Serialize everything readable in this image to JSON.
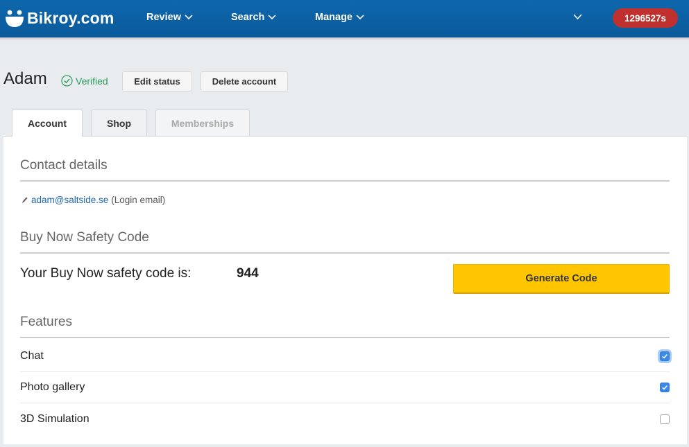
{
  "header": {
    "brand": "Bikroy.com",
    "nav": [
      {
        "label": "Review"
      },
      {
        "label": "Search"
      },
      {
        "label": "Manage"
      }
    ],
    "user_id_badge": "1296527s"
  },
  "profile": {
    "name": "Adam",
    "verified_label": "Verified",
    "edit_status_label": "Edit status",
    "delete_account_label": "Delete account"
  },
  "tabs": [
    {
      "label": "Account",
      "state": "active"
    },
    {
      "label": "Shop",
      "state": "inactive"
    },
    {
      "label": "Memberships",
      "state": "disabled"
    }
  ],
  "contact": {
    "title": "Contact details",
    "email": "adam@saltside.se",
    "email_note": "(Login email)"
  },
  "safety_code": {
    "title": "Buy Now Safety Code",
    "label": "Your Buy Now safety code is:",
    "value": "944",
    "generate_label": "Generate Code"
  },
  "features": {
    "title": "Features",
    "items": [
      {
        "label": "Chat",
        "checked": true
      },
      {
        "label": "Photo gallery",
        "checked": true
      },
      {
        "label": "3D Simulation",
        "checked": false
      }
    ]
  },
  "colors": {
    "topbar": "#0e67ad",
    "badge": "#c0302e",
    "generate_button": "#ffc600",
    "verified": "#2a9a5a",
    "link": "#1d68b0",
    "checkbox": "#3b88e6"
  }
}
